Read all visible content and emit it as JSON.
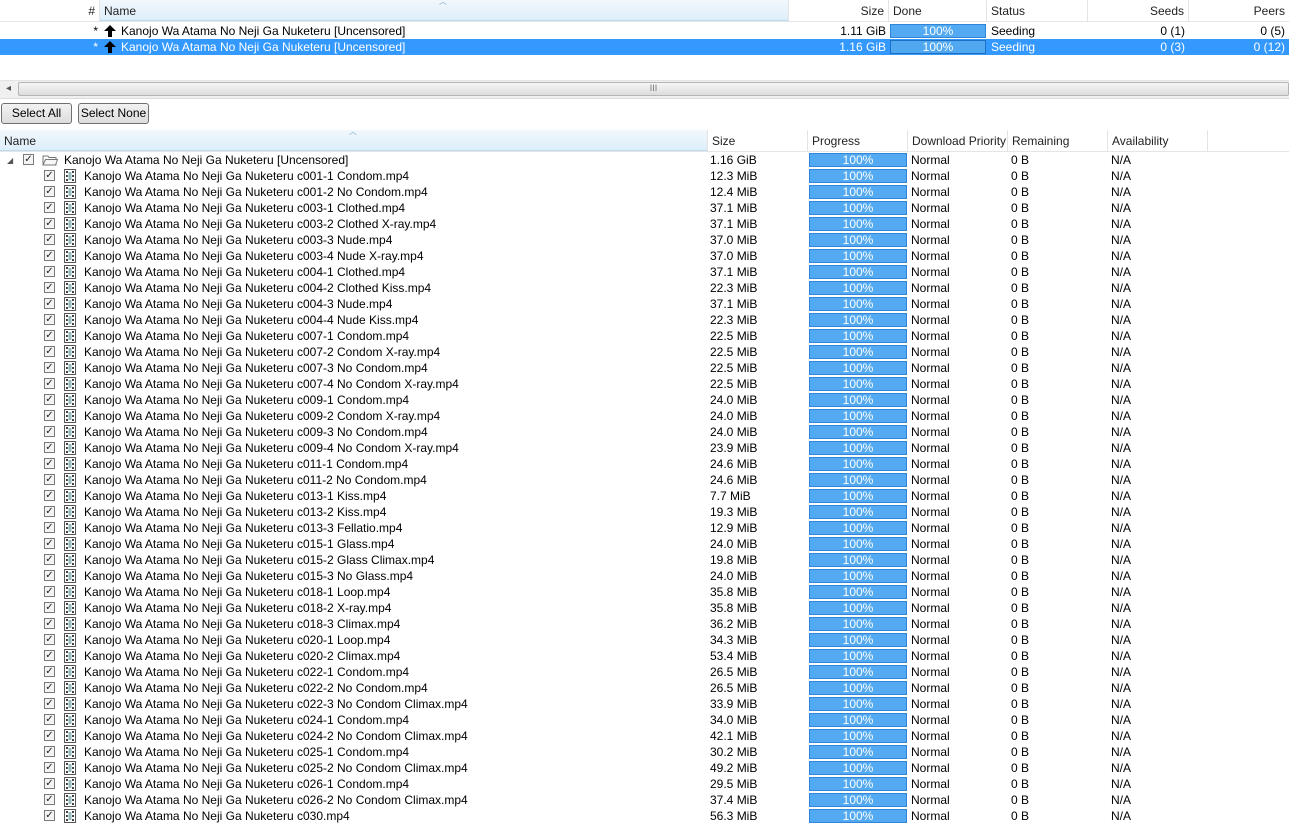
{
  "torrent_list": {
    "columns": {
      "num": "#",
      "name": "Name",
      "size": "Size",
      "done": "Done",
      "status": "Status",
      "seeds": "Seeds",
      "peers": "Peers"
    },
    "rows": [
      {
        "num": "*",
        "name": "Kanojo Wa Atama No Neji Ga Nuketeru [Uncensored]",
        "size": "1.11 GiB",
        "done": "100%",
        "status": "Seeding",
        "seeds": "0 (1)",
        "peers": "0 (5)",
        "selected": false
      },
      {
        "num": "*",
        "name": "Kanojo Wa Atama No Neji Ga Nuketeru [Uncensored]",
        "size": "1.16 GiB",
        "done": "100%",
        "status": "Seeding",
        "seeds": "0 (3)",
        "peers": "0 (12)",
        "selected": true
      }
    ]
  },
  "scrollbar": {
    "left_arrow": "◂",
    "grip": "III"
  },
  "buttons": {
    "select_all": "Select All",
    "select_none": "Select None"
  },
  "file_list": {
    "columns": {
      "name": "Name",
      "size": "Size",
      "progress": "Progress",
      "priority": "Download Priority",
      "remaining": "Remaining",
      "availability": "Availability"
    },
    "folder": {
      "name": "Kanojo Wa Atama No Neji Ga Nuketeru [Uncensored]",
      "size": "1.16 GiB",
      "progress": "100%",
      "priority": "Normal",
      "remaining": "0 B",
      "availability": "N/A",
      "checked": true
    },
    "files": [
      {
        "name": "Kanojo Wa Atama No Neji Ga Nuketeru c001-1 Condom.mp4",
        "size": "12.3 MiB"
      },
      {
        "name": "Kanojo Wa Atama No Neji Ga Nuketeru c001-2 No Condom.mp4",
        "size": "12.4 MiB"
      },
      {
        "name": "Kanojo Wa Atama No Neji Ga Nuketeru c003-1 Clothed.mp4",
        "size": "37.1 MiB"
      },
      {
        "name": "Kanojo Wa Atama No Neji Ga Nuketeru c003-2 Clothed X-ray.mp4",
        "size": "37.1 MiB"
      },
      {
        "name": "Kanojo Wa Atama No Neji Ga Nuketeru c003-3 Nude.mp4",
        "size": "37.0 MiB"
      },
      {
        "name": "Kanojo Wa Atama No Neji Ga Nuketeru c003-4 Nude X-ray.mp4",
        "size": "37.0 MiB"
      },
      {
        "name": "Kanojo Wa Atama No Neji Ga Nuketeru c004-1 Clothed.mp4",
        "size": "37.1 MiB"
      },
      {
        "name": "Kanojo Wa Atama No Neji Ga Nuketeru c004-2 Clothed Kiss.mp4",
        "size": "22.3 MiB"
      },
      {
        "name": "Kanojo Wa Atama No Neji Ga Nuketeru c004-3 Nude.mp4",
        "size": "37.1 MiB"
      },
      {
        "name": "Kanojo Wa Atama No Neji Ga Nuketeru c004-4 Nude Kiss.mp4",
        "size": "22.3 MiB"
      },
      {
        "name": "Kanojo Wa Atama No Neji Ga Nuketeru c007-1 Condom.mp4",
        "size": "22.5 MiB"
      },
      {
        "name": "Kanojo Wa Atama No Neji Ga Nuketeru c007-2 Condom X-ray.mp4",
        "size": "22.5 MiB"
      },
      {
        "name": "Kanojo Wa Atama No Neji Ga Nuketeru c007-3 No Condom.mp4",
        "size": "22.5 MiB"
      },
      {
        "name": "Kanojo Wa Atama No Neji Ga Nuketeru c007-4 No Condom X-ray.mp4",
        "size": "22.5 MiB"
      },
      {
        "name": "Kanojo Wa Atama No Neji Ga Nuketeru c009-1 Condom.mp4",
        "size": "24.0 MiB"
      },
      {
        "name": "Kanojo Wa Atama No Neji Ga Nuketeru c009-2 Condom X-ray.mp4",
        "size": "24.0 MiB"
      },
      {
        "name": "Kanojo Wa Atama No Neji Ga Nuketeru c009-3 No Condom.mp4",
        "size": "24.0 MiB"
      },
      {
        "name": "Kanojo Wa Atama No Neji Ga Nuketeru c009-4 No Condom X-ray.mp4",
        "size": "23.9 MiB"
      },
      {
        "name": "Kanojo Wa Atama No Neji Ga Nuketeru c011-1 Condom.mp4",
        "size": "24.6 MiB"
      },
      {
        "name": "Kanojo Wa Atama No Neji Ga Nuketeru c011-2 No Condom.mp4",
        "size": "24.6 MiB"
      },
      {
        "name": "Kanojo Wa Atama No Neji Ga Nuketeru c013-1 Kiss.mp4",
        "size": "7.7 MiB"
      },
      {
        "name": "Kanojo Wa Atama No Neji Ga Nuketeru c013-2 Kiss.mp4",
        "size": "19.3 MiB"
      },
      {
        "name": "Kanojo Wa Atama No Neji Ga Nuketeru c013-3 Fellatio.mp4",
        "size": "12.9 MiB"
      },
      {
        "name": "Kanojo Wa Atama No Neji Ga Nuketeru c015-1 Glass.mp4",
        "size": "24.0 MiB"
      },
      {
        "name": "Kanojo Wa Atama No Neji Ga Nuketeru c015-2 Glass Climax.mp4",
        "size": "19.8 MiB"
      },
      {
        "name": "Kanojo Wa Atama No Neji Ga Nuketeru c015-3 No Glass.mp4",
        "size": "24.0 MiB"
      },
      {
        "name": "Kanojo Wa Atama No Neji Ga Nuketeru c018-1 Loop.mp4",
        "size": "35.8 MiB"
      },
      {
        "name": "Kanojo Wa Atama No Neji Ga Nuketeru c018-2 X-ray.mp4",
        "size": "35.8 MiB"
      },
      {
        "name": "Kanojo Wa Atama No Neji Ga Nuketeru c018-3 Climax.mp4",
        "size": "36.2 MiB"
      },
      {
        "name": "Kanojo Wa Atama No Neji Ga Nuketeru c020-1 Loop.mp4",
        "size": "34.3 MiB"
      },
      {
        "name": "Kanojo Wa Atama No Neji Ga Nuketeru c020-2 Climax.mp4",
        "size": "53.4 MiB"
      },
      {
        "name": "Kanojo Wa Atama No Neji Ga Nuketeru c022-1 Condom.mp4",
        "size": "26.5 MiB"
      },
      {
        "name": "Kanojo Wa Atama No Neji Ga Nuketeru c022-2 No Condom.mp4",
        "size": "26.5 MiB"
      },
      {
        "name": "Kanojo Wa Atama No Neji Ga Nuketeru c022-3 No Condom Climax.mp4",
        "size": "33.9 MiB"
      },
      {
        "name": "Kanojo Wa Atama No Neji Ga Nuketeru c024-1 Condom.mp4",
        "size": "34.0 MiB"
      },
      {
        "name": "Kanojo Wa Atama No Neji Ga Nuketeru c024-2 No Condom Climax.mp4",
        "size": "42.1 MiB"
      },
      {
        "name": "Kanojo Wa Atama No Neji Ga Nuketeru c025-1 Condom.mp4",
        "size": "30.2 MiB"
      },
      {
        "name": "Kanojo Wa Atama No Neji Ga Nuketeru c025-2 No Condom Climax.mp4",
        "size": "49.2 MiB"
      },
      {
        "name": "Kanojo Wa Atama No Neji Ga Nuketeru c026-1 Condom.mp4",
        "size": "29.5 MiB"
      },
      {
        "name": "Kanojo Wa Atama No Neji Ga Nuketeru c026-2 No Condom Climax.mp4",
        "size": "37.4 MiB"
      },
      {
        "name": "Kanojo Wa Atama No Neji Ga Nuketeru c030.mp4",
        "size": "56.3 MiB"
      }
    ],
    "file_defaults": {
      "progress": "100%",
      "priority": "Normal",
      "remaining": "0 B",
      "availability": "N/A",
      "checked": true
    }
  },
  "colors": {
    "selection": "#3399ff",
    "progress_fill": "#54aaf2"
  },
  "icons": {
    "torrent_status": "upload-arrow-icon",
    "folder": "folder-open-icon",
    "file": "video-file-icon",
    "checkbox": "checkbox-checked-icon"
  }
}
